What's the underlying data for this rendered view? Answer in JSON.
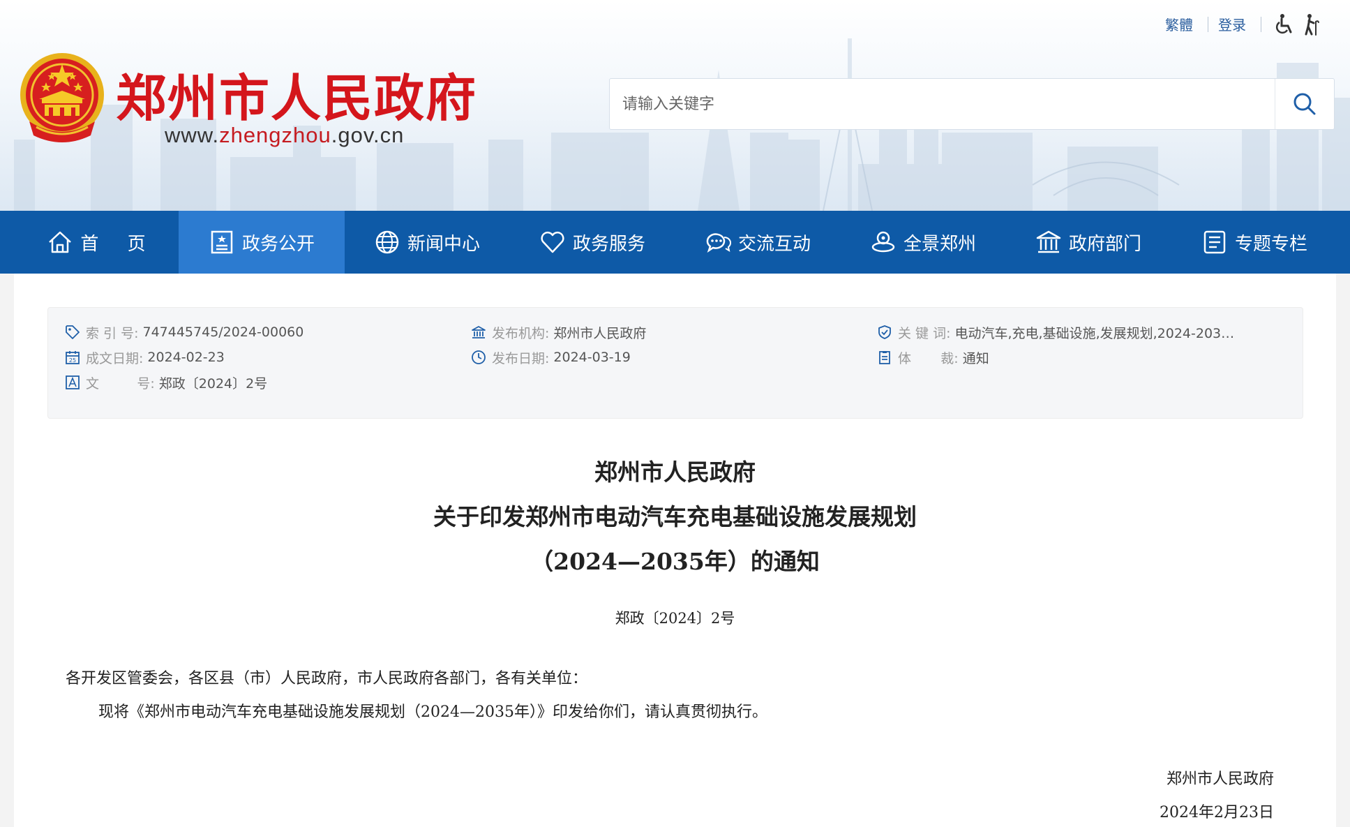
{
  "top_links": {
    "traditional": "繁體",
    "login": "登录",
    "accessibility_icon": "wheelchair-icon",
    "elderly_icon": "elderly-icon"
  },
  "site": {
    "title": "郑州市人民政府",
    "url_prefix": "www.",
    "url_highlight": "zhengzhou",
    "url_suffix": ".gov.cn",
    "brand_color": "#d4161c"
  },
  "search": {
    "placeholder": "请输入关键字",
    "value": ""
  },
  "nav": {
    "active_color": "#2c7bd0",
    "bar_color": "#0e5aa7",
    "items": [
      {
        "label": "首     页",
        "icon": "home-icon"
      },
      {
        "label": "政务公开",
        "icon": "document-icon",
        "active": true
      },
      {
        "label": "新闻中心",
        "icon": "globe-icon"
      },
      {
        "label": "政务服务",
        "icon": "heart-icon"
      },
      {
        "label": "交流互动",
        "icon": "chat-icon"
      },
      {
        "label": "全景郑州",
        "icon": "panorama-icon"
      },
      {
        "label": "政府部门",
        "icon": "building-icon"
      },
      {
        "label": "专题专栏",
        "icon": "list-icon"
      }
    ]
  },
  "meta": {
    "index_label": "索 引 号:",
    "index_value": "747445745/2024-00060",
    "date_label": "成文日期:",
    "date_value": "2024-02-23",
    "docno_label": "文         号:",
    "docno_value": "郑政〔2024〕2号",
    "org_label": "发布机构:",
    "org_value": "郑州市人民政府",
    "pubdate_label": "发布日期:",
    "pubdate_value": "2024-03-19",
    "keywords_label": "关 键 词:",
    "keywords_value": "电动汽车,充电,基础设施,发展规划,2024-203…",
    "genre_label": "体       裁:",
    "genre_value": "通知"
  },
  "document": {
    "title_line1": "郑州市人民政府",
    "title_line2": "关于印发郑州市电动汽车充电基础设施发展规划",
    "title_line3": "（2024—2035年）的通知",
    "number": "郑政〔2024〕2号",
    "addressee": "各开发区管委会，各区县（市）人民政府，市人民政府各部门，各有关单位：",
    "body": "现将《郑州市电动汽车充电基础设施发展规划（2024—2035年）》印发给你们，请认真贯彻执行。",
    "signature": "郑州市人民政府",
    "sign_date": "2024年2月23日"
  }
}
